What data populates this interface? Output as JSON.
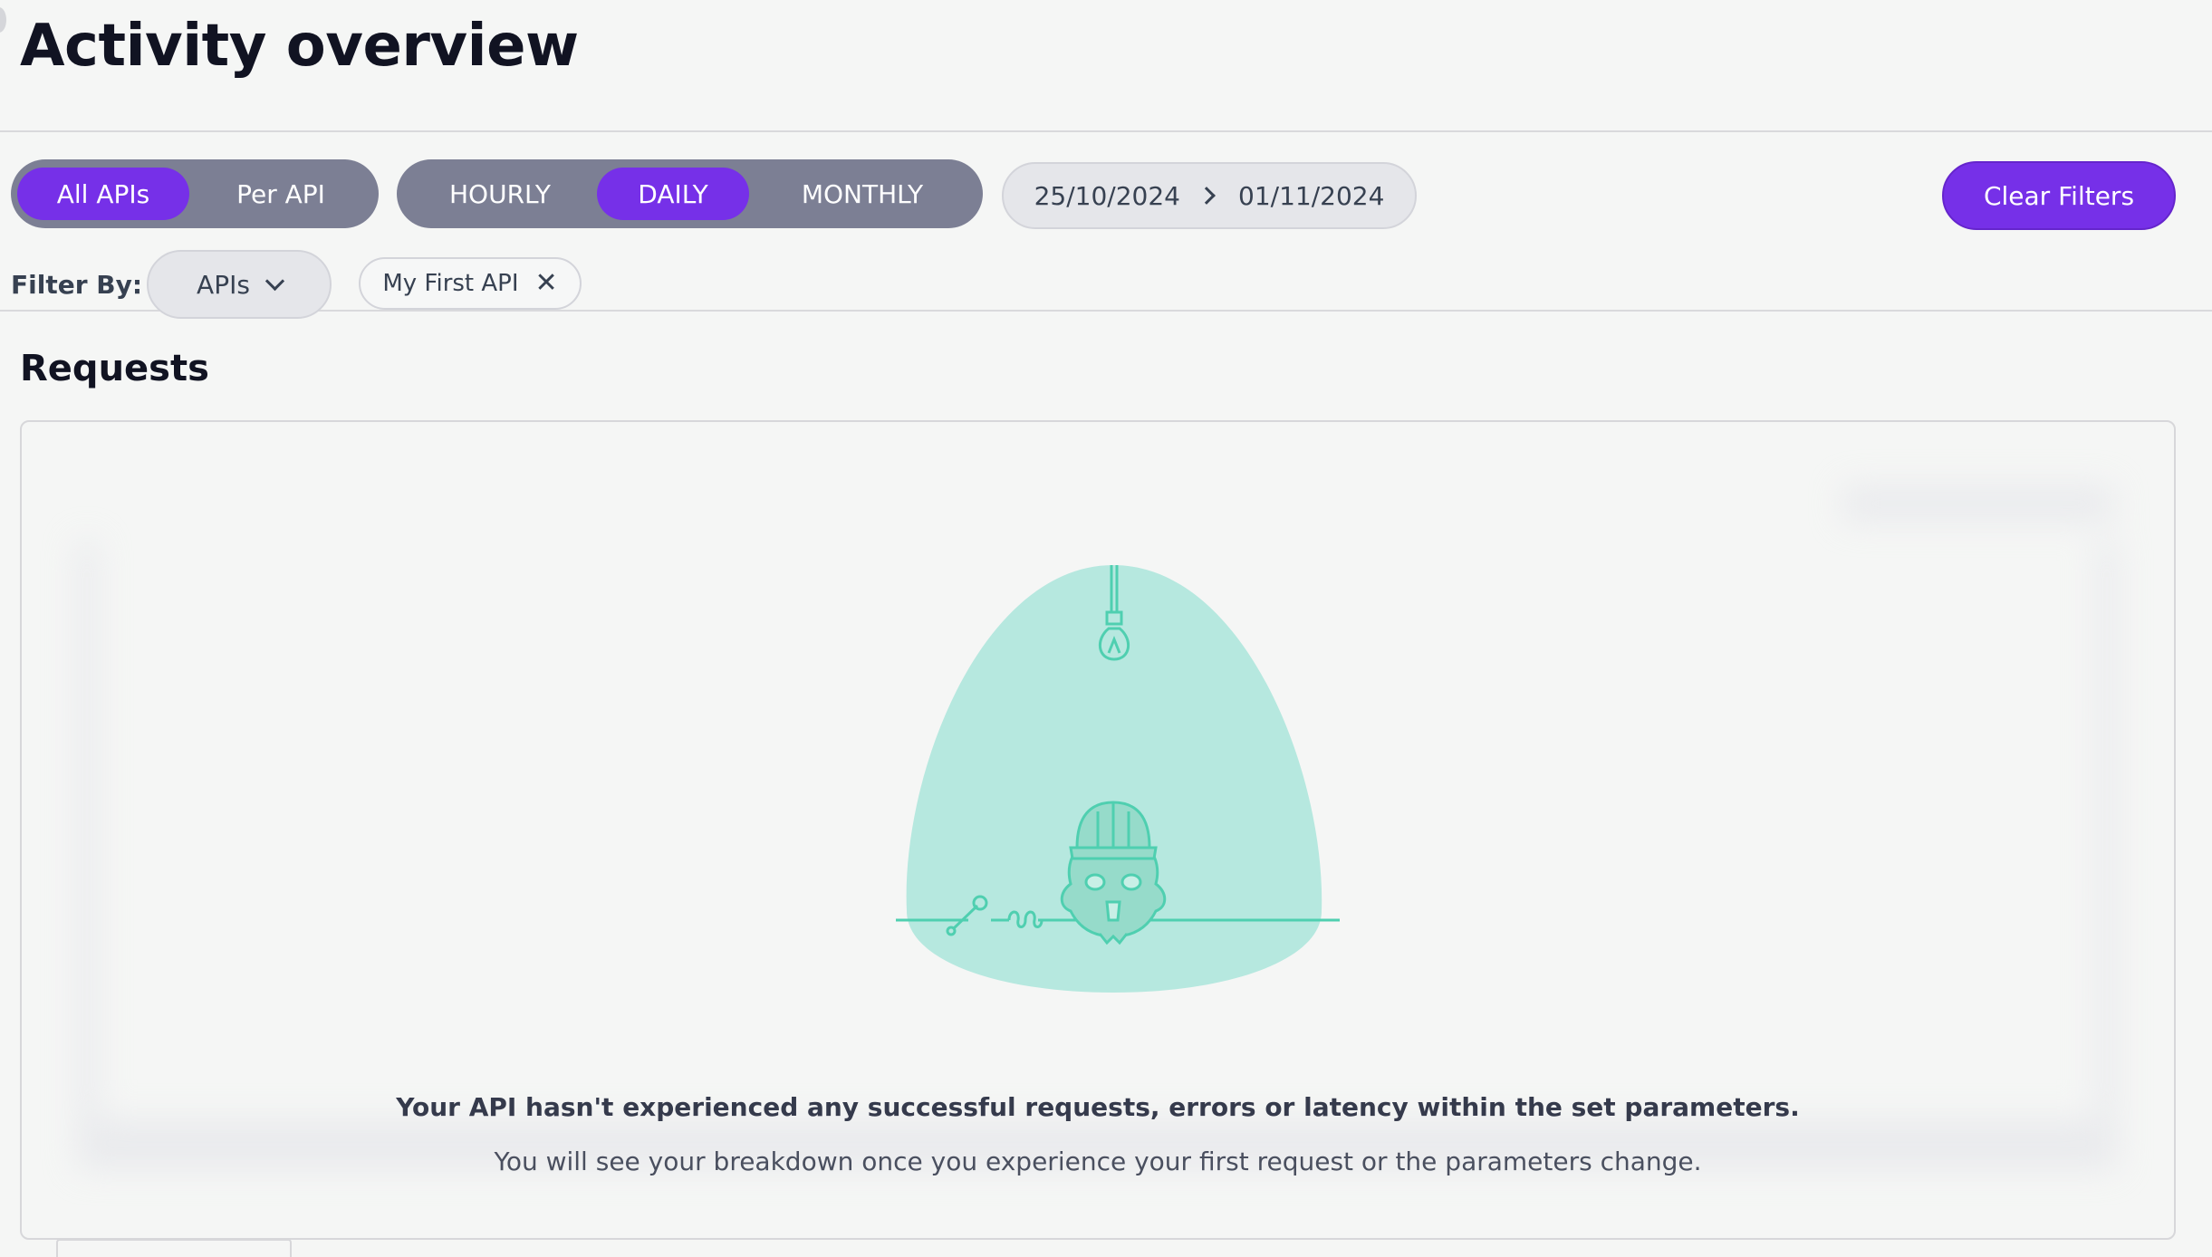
{
  "header": {
    "title": "Activity overview"
  },
  "toolbar": {
    "api_scope": [
      {
        "label": "All APIs",
        "active": true
      },
      {
        "label": "Per API",
        "active": false
      }
    ],
    "granularity": [
      {
        "label": "HOURLY",
        "active": false
      },
      {
        "label": "DAILY",
        "active": true
      },
      {
        "label": "MONTHLY",
        "active": false
      }
    ],
    "date_range": {
      "start": "25/10/2024",
      "end": "01/11/2024"
    },
    "clear_filters_label": "Clear Filters",
    "filter_label": "Filter By:",
    "filter_dropdown_label": "APIs",
    "active_filter_chip": "My First API"
  },
  "requests": {
    "title": "Requests",
    "empty_title": "Your API hasn't experienced any successful requests, errors or latency within the set parameters.",
    "empty_description": "You will see your breakdown once you experience your first request or the parameters change."
  },
  "colors": {
    "accent": "#7630e8",
    "segment_bg": "#7c7f94",
    "illustration_fill": "#b6e8df",
    "illustration_stroke": "#4fcfb0"
  }
}
